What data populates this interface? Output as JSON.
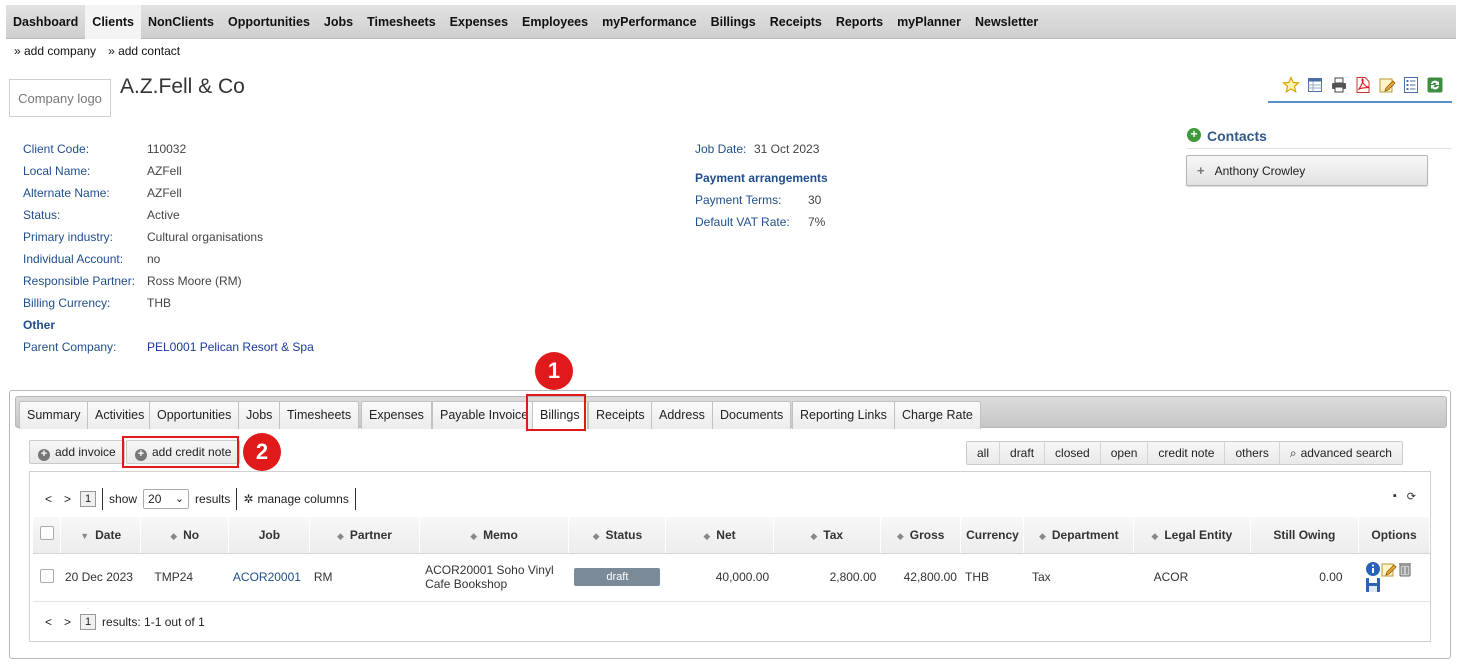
{
  "nav": {
    "items": [
      "Dashboard",
      "Clients",
      "NonClients",
      "Opportunities",
      "Jobs",
      "Timesheets",
      "Expenses",
      "Employees",
      "myPerformance",
      "Billings",
      "Receipts",
      "Reports",
      "myPlanner",
      "Newsletter"
    ],
    "active": "Clients"
  },
  "subnav": {
    "add_company": "» add company",
    "add_contact": "» add contact"
  },
  "company": {
    "logo_text": "Company logo",
    "name": "A.Z.Fell & Co"
  },
  "details": {
    "client_code_label": "Client Code:",
    "client_code": "110032",
    "local_name_label": "Local Name:",
    "local_name": "AZFell",
    "alt_name_label": "Alternate Name:",
    "alt_name": "AZFell",
    "status_label": "Status:",
    "status": "Active",
    "industry_label": "Primary industry:",
    "industry": "Cultural organisations",
    "individual_label": "Individual Account:",
    "individual": "no",
    "partner_label": "Responsible Partner:",
    "partner": "Ross Moore (RM)",
    "currency_label": "Billing Currency:",
    "currency": "THB",
    "other_heading": "Other",
    "parent_label": "Parent Company:",
    "parent": "PEL0001 Pelican Resort & Spa"
  },
  "job_info": {
    "job_date_label": "Job Date:",
    "job_date": "31 Oct 2023",
    "payment_heading": "Payment arrangements",
    "terms_label": "Payment Terms:",
    "terms": "30",
    "vat_label": "Default VAT Rate:",
    "vat": "7%"
  },
  "contacts": {
    "title": "Contacts",
    "items": [
      "Anthony Crowley"
    ]
  },
  "tabs": [
    "Summary",
    "Activities",
    "Opportunities",
    "Jobs",
    "Timesheets",
    "Expenses",
    "Payable Invoice",
    "Billings",
    "Receipts",
    "Address",
    "Documents",
    "Reporting Links",
    "Charge Rate"
  ],
  "active_tab": "Billings",
  "annotations": {
    "first": "1",
    "second": "2"
  },
  "actions": {
    "add_invoice": "add invoice",
    "add_credit_note": "add credit note"
  },
  "filters": [
    "all",
    "draft",
    "closed",
    "open",
    "credit note",
    "others",
    "advanced search"
  ],
  "grid": {
    "pager": {
      "prev": "<",
      "next": ">",
      "page": "1",
      "show_label": "show",
      "page_size": "20",
      "results_label": "results",
      "manage_columns": "manage columns",
      "results_summary": "results: 1-1 out of 1"
    },
    "columns": [
      "Date",
      "No",
      "Job",
      "Partner",
      "Memo",
      "Status",
      "Net",
      "Tax",
      "Gross",
      "Currency",
      "Department",
      "Legal Entity",
      "Still Owing",
      "Options"
    ],
    "rows": [
      {
        "date": "20 Dec 2023",
        "no": "TMP24",
        "job": "ACOR20001",
        "partner": "RM",
        "memo": "ACOR20001 Soho Vinyl Cafe Bookshop",
        "status": "draft",
        "net": "40,000.00",
        "tax": "2,800.00",
        "gross": "42,800.00",
        "currency": "THB",
        "department": "Tax",
        "legal_entity": "ACOR",
        "still_owing": "0.00"
      }
    ]
  },
  "colors": {
    "highlight": "#e0191b",
    "link": "#1f4e8c",
    "draft": "#7b8a99"
  }
}
